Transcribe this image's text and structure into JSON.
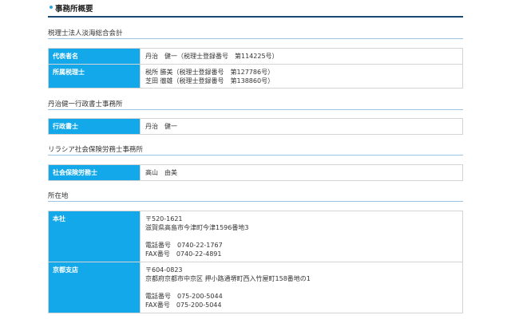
{
  "page_title": "事務所概要",
  "sections": [
    {
      "title": "税理士法人淡海総合会計",
      "rows": [
        {
          "head": "代表者名",
          "lines": [
            "丹治　健一（税理士登録番号　第114225号）"
          ]
        },
        {
          "head": "所属税理士",
          "lines": [
            "税所 勝美（税理士登録番号　第127786号）",
            "芝田 徹雄（税理士登録番号　第138860号）"
          ]
        }
      ]
    },
    {
      "title": "丹治健一行政書士事務所",
      "rows": [
        {
          "head": "行政書士",
          "lines": [
            "丹治　健一"
          ]
        }
      ]
    },
    {
      "title": "リラシア社会保険労務士事務所",
      "rows": [
        {
          "head": "社会保険労務士",
          "lines": [
            "高山　由美"
          ]
        }
      ]
    },
    {
      "title": "所在地",
      "rows": [
        {
          "head": "本社",
          "postal": "〒520-1621",
          "address": "滋賀県高島市今津町今津1596番地3",
          "tel": "電話番号　0740-22-1767",
          "fax": "FAX番号　0740-22-4891"
        },
        {
          "head": "京都支店",
          "postal": "〒604-0823",
          "address": "京都府京都市中京区 押小路通堺町西入竹屋町158番地の1",
          "tel": "電話番号　075-200-5044",
          "fax": "FAX番号　075-200-5044"
        }
      ]
    }
  ]
}
